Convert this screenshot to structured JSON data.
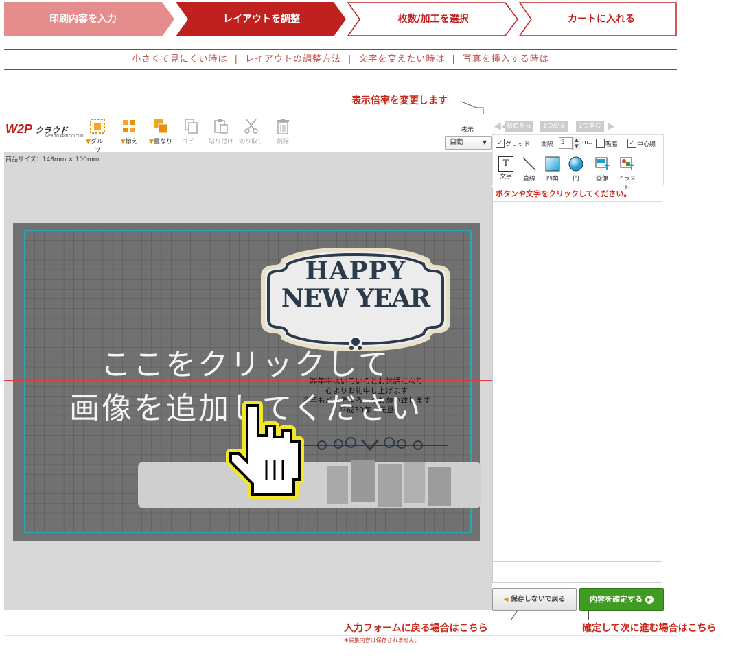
{
  "steps": [
    {
      "label": "印刷内容を入力",
      "state": "done"
    },
    {
      "label": "レイアウトを調整",
      "state": "current"
    },
    {
      "label": "枚数/加工を選択",
      "state": "todo"
    },
    {
      "label": "カートに入れる",
      "state": "todo"
    }
  ],
  "help_links": [
    "小さくて見にくい時は",
    "レイアウトの調整方法",
    "文字を変えたい時は",
    "写真を挿入する時は"
  ],
  "help_separator": "|",
  "callouts": {
    "zoom": "表示倍率を変更します",
    "back": "入力フォームに戻る場合はこちら",
    "back_sub": "※編集内容は保存されません。",
    "confirm": "確定して次に進む場合はこちら"
  },
  "logo": {
    "main": "W2P",
    "sub": "クラウド",
    "tagline": "WEB TO PRINT CLOUD"
  },
  "toolbar": {
    "group": "グループ",
    "align": "揃え",
    "stack": "重なり",
    "copy": "コピー",
    "paste": "貼り付け",
    "cut": "切り取り",
    "delete": "削除",
    "view_label": "表示",
    "zoom_value": "自動"
  },
  "history": {
    "first": "初めから",
    "undo": "1つ戻る",
    "redo": "1つ進む"
  },
  "grid_options": {
    "grid": "グリッド",
    "interval_label": "間隔",
    "interval_value": "5",
    "unit": "m..",
    "snap": "吸着",
    "center": "中心線",
    "grid_checked": true,
    "snap_checked": false,
    "center_checked": true
  },
  "tools": [
    "文字",
    "直線",
    "四角",
    "円",
    "画像",
    "イラスト"
  ],
  "panel_message": "ボタンや文字をクリックしてください。",
  "canvas": {
    "product_size": "商品サイズ：148mm × 100mm",
    "card_title_1": "HAPPY",
    "card_title_2": "NEW YEAR",
    "greeting": [
      "昨年中はいろいろとお世話になり",
      "心よりお礼申し上げます",
      "今年もどうぞよろしくお願い致します",
      "平成30年　元旦"
    ],
    "overlay_1": "ここをクリックして",
    "overlay_2": "画像を追加してください"
  },
  "buttons": {
    "back": "保存しないで戻る",
    "confirm": "内容を確定する"
  },
  "colors": {
    "accent_red": "#c0211f",
    "step_done": "#e58d8d",
    "confirm_green": "#3f9b22",
    "grid_cyan": "#17b8c8"
  }
}
